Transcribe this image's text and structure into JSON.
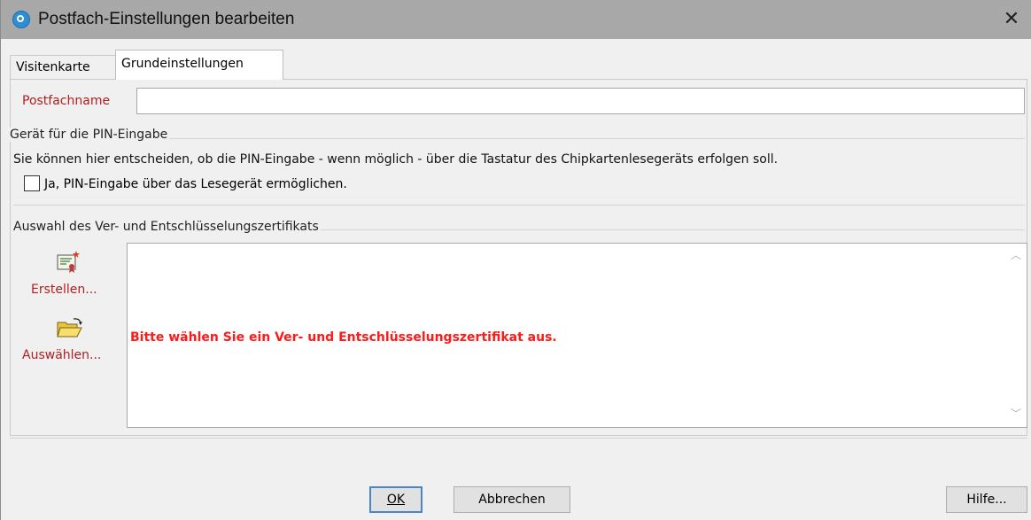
{
  "window": {
    "title": "Postfach-Einstellungen bearbeiten",
    "close_glyph": "✕",
    "icon": "app-logo-icon"
  },
  "tabs": [
    {
      "label": "Visitenkarte",
      "active": false
    },
    {
      "label": "Grundeinstellungen",
      "active": true
    }
  ],
  "postfach": {
    "label": "Postfachname",
    "value": "",
    "placeholder": ""
  },
  "pin": {
    "legend": "Gerät für die PIN-Eingabe",
    "description": "Sie können hier entscheiden, ob die PIN-Eingabe - wenn möglich - über die Tastatur des Chipkartenlesegeräts erfolgen soll.",
    "checkbox_label": "Ja, PIN-Eingabe über das Lesegerät ermöglichen.",
    "checked": false
  },
  "cert": {
    "legend": "Auswahl des Ver- und Entschlüsselungszertifikats",
    "create_label": "Erstellen...",
    "create_icon": "certificate-new-icon",
    "select_label": "Auswählen...",
    "select_icon": "folder-open-icon",
    "message": "Bitte wählen Sie ein Ver- und Entschlüsselungszertifikat aus.",
    "message_color": "#ff1a1a"
  },
  "buttons": {
    "ok_label": "OK",
    "cancel_label": "Abbrechen",
    "help_label": "Hilfe..."
  },
  "colors": {
    "label_red": "#b02020",
    "ok_border": "#4a86c5"
  }
}
